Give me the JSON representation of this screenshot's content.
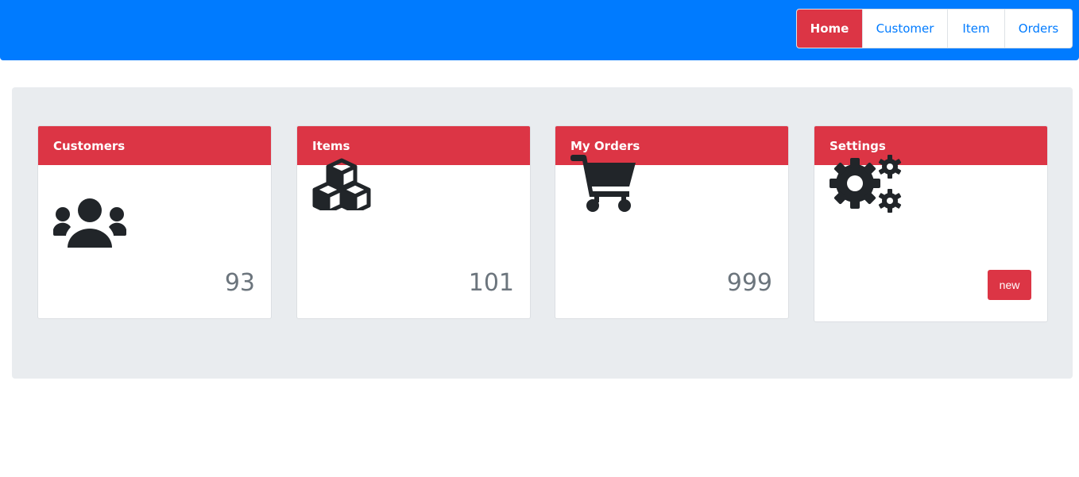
{
  "nav": {
    "items": [
      {
        "label": "Home",
        "active": true
      },
      {
        "label": "Customer",
        "active": false
      },
      {
        "label": "Item",
        "active": false
      },
      {
        "label": "Orders",
        "active": false
      }
    ]
  },
  "cards": [
    {
      "title": "Customers",
      "icon": "users-icon",
      "count": "93"
    },
    {
      "title": "Items",
      "icon": "cubes-icon",
      "count": "101"
    },
    {
      "title": "My Orders",
      "icon": "cart-icon",
      "count": "999"
    },
    {
      "title": "Settings",
      "icon": "gears-icon",
      "button_label": "new"
    }
  ],
  "colors": {
    "topbar": "#007bff",
    "accent": "#dc3545",
    "jumbotron": "#e9ecef",
    "icon": "#212529",
    "count": "#6c757d"
  }
}
